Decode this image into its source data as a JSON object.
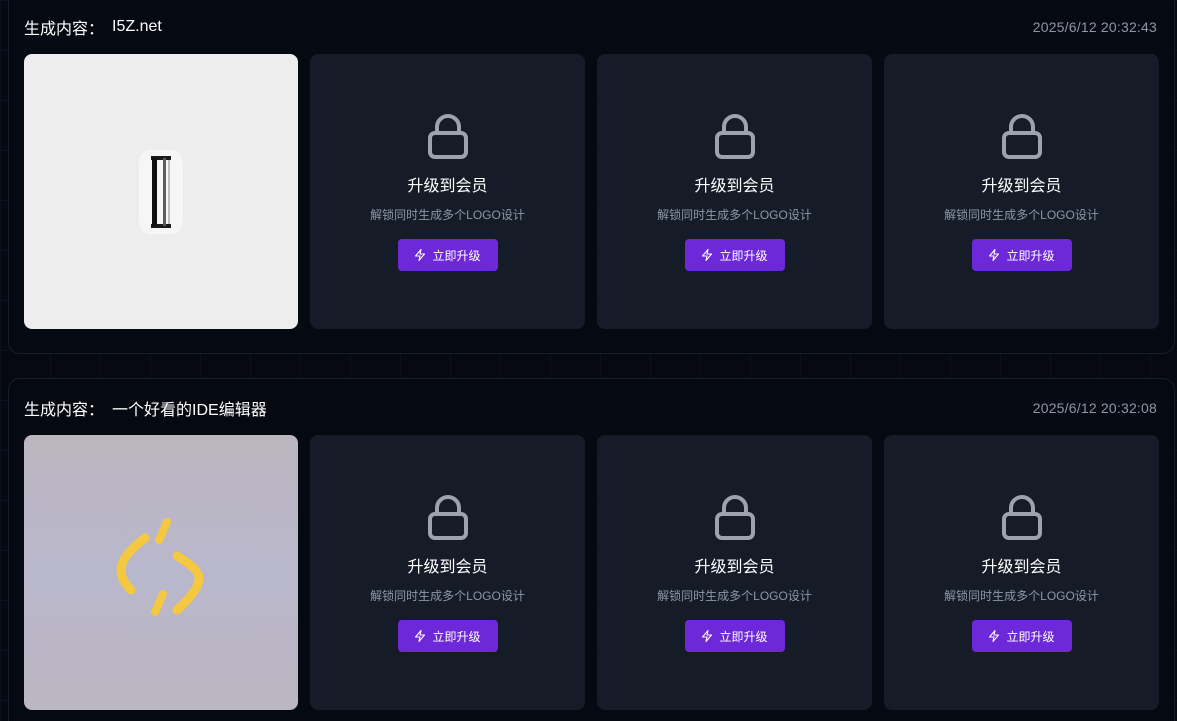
{
  "results": [
    {
      "prompt_label": "生成内容：",
      "prompt_text": "I5Z.net",
      "timestamp": "2025/6/12 20:32:43",
      "locked_cards": [
        {
          "title": "升级到会员",
          "subtitle": "解锁同时生成多个LOGO设计",
          "button": "立即升级"
        },
        {
          "title": "升级到会员",
          "subtitle": "解锁同时生成多个LOGO设计",
          "button": "立即升级"
        },
        {
          "title": "升级到会员",
          "subtitle": "解锁同时生成多个LOGO设计",
          "button": "立即升级"
        }
      ]
    },
    {
      "prompt_label": "生成内容：",
      "prompt_text": "一个好看的IDE编辑器",
      "timestamp": "2025/6/12 20:32:08",
      "locked_cards": [
        {
          "title": "升级到会员",
          "subtitle": "解锁同时生成多个LOGO设计",
          "button": "立即升级"
        },
        {
          "title": "升级到会员",
          "subtitle": "解锁同时生成多个LOGO设计",
          "button": "立即升级"
        },
        {
          "title": "升级到会员",
          "subtitle": "解锁同时生成多个LOGO设计",
          "button": "立即升级"
        }
      ]
    }
  ],
  "icons": {
    "lock": "lock-icon",
    "button": "lightning-icon"
  },
  "colors": {
    "background": "#060912",
    "card": "#151b27",
    "accent": "#6d28d9",
    "muted_text": "#8e96a6"
  }
}
